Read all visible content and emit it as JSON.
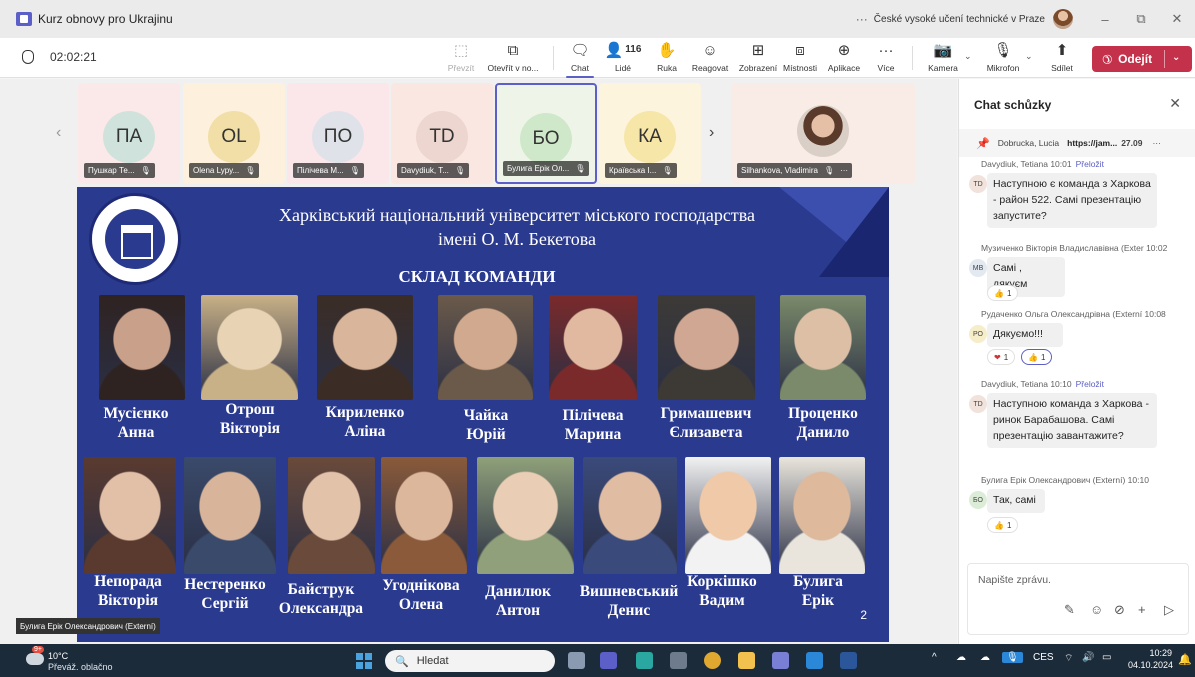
{
  "window": {
    "title": "Kurz obnovy pro Ukrajinu",
    "more": "···",
    "org": "České vysoké učení technické v Praze",
    "min": "–",
    "restore": "⧉",
    "close": "✕"
  },
  "toolbar": {
    "timer": "02:02:21",
    "buttons": {
      "prevzit": "Převzít",
      "otevrit": "Otevřít v no...",
      "chat": "Chat",
      "lide": "Lidé",
      "lide_count": "116",
      "ruka": "Ruka",
      "reagovat": "Reagovat",
      "zobrazeni": "Zobrazení",
      "mistnosti": "Místnosti",
      "aplikace": "Aplikace",
      "vice": "Více",
      "kamera": "Kamera",
      "mikrofon": "Mikrofon",
      "sdilet": "Sdílet"
    },
    "leave": "Odejít",
    "accent": "#5b5fc7",
    "leave_color": "#c4314b"
  },
  "participants": [
    {
      "initials": "ПА",
      "name": "Пушкар Те...",
      "bg": "#fbe9e9",
      "avatar": "#cfe3dc"
    },
    {
      "initials": "OL",
      "name": "Olena Lypy...",
      "bg": "#fdf0dc",
      "avatar": "#f1dfa7"
    },
    {
      "initials": "ПО",
      "name": "Пілічева М...",
      "bg": "#fbe6ea",
      "avatar": "#dfe3e9"
    },
    {
      "initials": "TD",
      "name": "Davydiuk, T...",
      "bg": "#fbe7e1",
      "avatar": "#ecd6cf"
    },
    {
      "initials": "БО",
      "name": "Булига Ерік Ол...",
      "bg": "#eef5e8",
      "avatar": "#cfe8c9"
    },
    {
      "initials": "КА",
      "name": "Краївська І...",
      "bg": "#fdf4dd",
      "avatar": "#f6e6a8"
    }
  ],
  "pinned_participant": {
    "name": "Silhankova, Vladimira",
    "more": "···"
  },
  "slide": {
    "title_line1": "Харківський національний університет міського господарства",
    "title_line2": "імені О. М. Бекетова",
    "heading": "СКЛАД КОМАНДИ",
    "page": "2",
    "row1": [
      {
        "first": "Мусієнко",
        "last": "Анна"
      },
      {
        "first": "Отрош",
        "last": "Вікторія"
      },
      {
        "first": "Кириленко",
        "last": "Аліна"
      },
      {
        "first": "Чайка",
        "last": "Юрій"
      },
      {
        "first": "Пілічева",
        "last": "Марина"
      },
      {
        "first": "Гримашевич",
        "last": "Єлизавета"
      },
      {
        "first": "Проценко",
        "last": "Данило"
      }
    ],
    "row2": [
      {
        "first": "Непорада",
        "last": "Вікторія"
      },
      {
        "first": "Нестеренко",
        "last": "Сергій"
      },
      {
        "first": "Байструк",
        "last": "Олександра"
      },
      {
        "first": "Угоднікова",
        "last": "Олена"
      },
      {
        "first": "Данилюк",
        "last": "Антон"
      },
      {
        "first": "Вишневський",
        "last": "Денис"
      },
      {
        "first": "Коркішко",
        "last": "Вадим"
      },
      {
        "first": "Булига",
        "last": "Ерік"
      }
    ]
  },
  "presenter_label": "Булига Ерік Олександрович (Externí)",
  "chat": {
    "title": "Chat schůzky",
    "pinned": {
      "author": "Dobrucka, Lucia",
      "link": "https://jam...",
      "date": "27.09"
    },
    "messages": [
      {
        "initials": "TD",
        "author": "Davydiuk, Tetiana",
        "time": "10:01",
        "translate": "Přeložit",
        "text": "Наступною є команда з Харкова - район 522. Самі презентацію запустите?"
      },
      {
        "initials": "МВ",
        "author": "Музиченко Вікторія Владиславівна (Exter",
        "time": "10:02",
        "text": "Самі , дякуєм",
        "reaction": "👍",
        "reaction_count": "1"
      },
      {
        "initials": "РО",
        "author": "Рудаченко Ольга Олександрівна (Externí",
        "time": "10:08",
        "text": "Дякуємо!!!",
        "reaction_heart": "❤",
        "reaction_heart_count": "1",
        "reaction": "👍",
        "reaction_count": "1"
      },
      {
        "initials": "TD",
        "author": "Davydiuk, Tetiana",
        "time": "10:10",
        "translate": "Přeložit",
        "text": "Наступною команда з Харкова - ринок Барабашова. Самі презентацію завантажите?"
      },
      {
        "initials": "БО",
        "author": "Булига Ерік Олександрович (Externí)",
        "time": "10:10",
        "text": "Так, самі",
        "reaction": "👍",
        "reaction_count": "1"
      }
    ],
    "compose_placeholder": "Napište zprávu."
  },
  "taskbar": {
    "weather_temp": "10°C",
    "weather_desc": "Převáž. oblačno",
    "weather_badge": "9+",
    "search": "Hledat",
    "lang": "CES",
    "time": "10:29",
    "date": "04.10.2024"
  }
}
